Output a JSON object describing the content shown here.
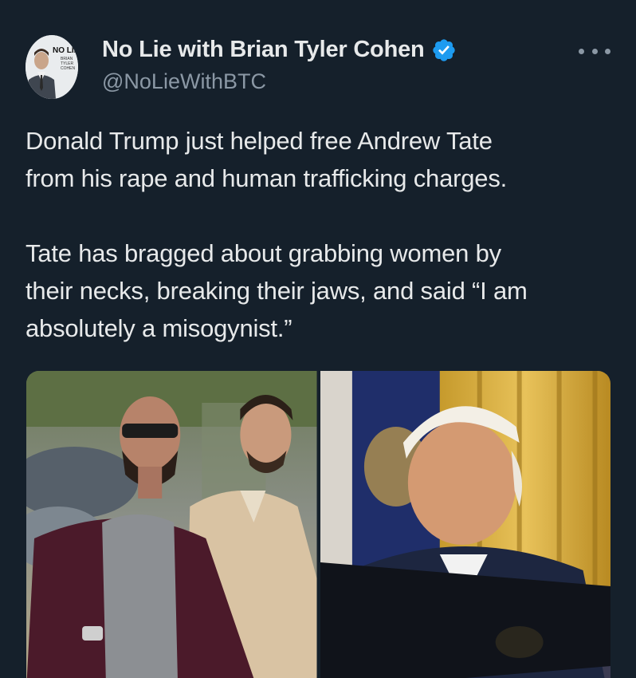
{
  "author": {
    "display_name": "No Lie with Brian Tyler Cohen",
    "handle": "@NoLieWithBTC",
    "verified": true,
    "avatar_logo_text": "NO LIE",
    "avatar_logo_subtext": "BRIAN TYLER COHEN"
  },
  "tweet": {
    "paragraph1_line1": "Donald Trump just helped free Andrew Tate",
    "paragraph1_line2": "from his rape and human trafficking charges.",
    "paragraph2_line1": "Tate has bragged about grabbing women by",
    "paragraph2_line2": "their necks, breaking their jaws, and said “I am",
    "paragraph2_line3": "absolutely a misogynist.”"
  },
  "media": {
    "count": 2,
    "photos": [
      "photo-two-men-walking",
      "photo-man-at-desk-with-folder"
    ]
  },
  "icons": {
    "verified": "verified-badge-icon",
    "more": "more-options-icon"
  },
  "colors": {
    "background": "#15202b",
    "text_primary": "#e7e9ea",
    "text_secondary": "#8b98a5",
    "verified_blue": "#1d9bf0"
  }
}
